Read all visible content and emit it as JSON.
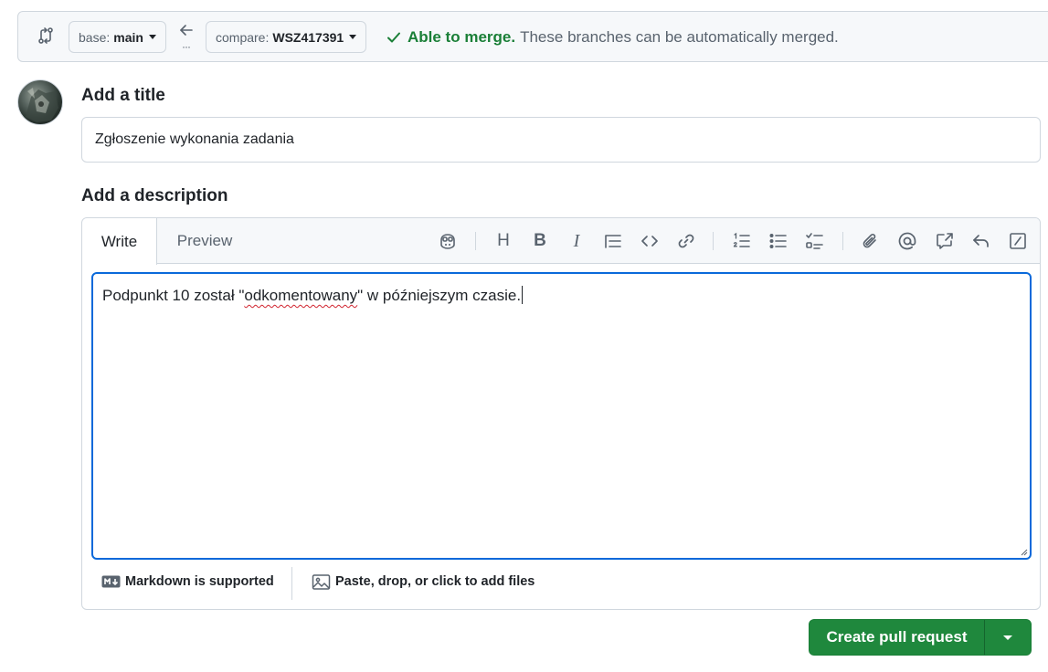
{
  "compare": {
    "base_label": "base:",
    "base_value": "main",
    "compare_label": "compare:",
    "compare_value": "WSZ417391",
    "arrow_icon": "arrow-left-icon",
    "status_title": "Able to merge.",
    "status_message": "These branches can be automatically merged.",
    "status_color": "#1a7f37"
  },
  "form": {
    "title_heading": "Add a title",
    "title_value": "Zgłoszenie wykonania zadania",
    "description_heading": "Add a description"
  },
  "editor": {
    "tabs": [
      {
        "label": "Write",
        "active": true
      },
      {
        "label": "Preview",
        "active": false
      }
    ],
    "toolbar": [
      "copilot-icon",
      "heading-icon",
      "bold-icon",
      "italic-icon",
      "quote-icon",
      "code-icon",
      "link-icon",
      "ordered-list-icon",
      "unordered-list-icon",
      "task-list-icon",
      "attach-icon",
      "mention-icon",
      "reference-icon",
      "reply-icon",
      "slash-command-icon"
    ],
    "toolbar_heading_glyph": "H",
    "toolbar_bold_glyph": "B",
    "toolbar_italic_glyph": "I",
    "text_before": "Podpunkt 10 został \"",
    "text_misspelled": "odkomentowany",
    "text_after": "\" w późniejszym czasie.",
    "footer_markdown": "Markdown is supported",
    "footer_files": "Paste, drop, or click to add files"
  },
  "actions": {
    "create_label": "Create pull request",
    "accent_color": "#1f883d"
  }
}
